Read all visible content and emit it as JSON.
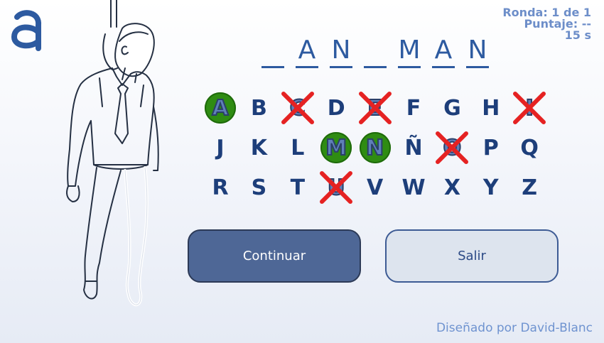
{
  "hud": {
    "round": "Ronda: 1 de 1",
    "score": "Puntaje: --",
    "timer": "15 s"
  },
  "word": {
    "slots": [
      "",
      "A",
      "N",
      "",
      "M",
      "A",
      "N"
    ]
  },
  "keyboard": {
    "rows": [
      [
        {
          "letter": "A",
          "state": "correct"
        },
        {
          "letter": "B",
          "state": "unused"
        },
        {
          "letter": "C",
          "state": "wrong"
        },
        {
          "letter": "D",
          "state": "unused"
        },
        {
          "letter": "E",
          "state": "wrong"
        },
        {
          "letter": "F",
          "state": "unused"
        },
        {
          "letter": "G",
          "state": "unused"
        },
        {
          "letter": "H",
          "state": "unused"
        },
        {
          "letter": "I",
          "state": "wrong"
        }
      ],
      [
        {
          "letter": "J",
          "state": "unused"
        },
        {
          "letter": "K",
          "state": "unused"
        },
        {
          "letter": "L",
          "state": "unused"
        },
        {
          "letter": "M",
          "state": "correct"
        },
        {
          "letter": "N",
          "state": "correct"
        },
        {
          "letter": "Ñ",
          "state": "unused"
        },
        {
          "letter": "O",
          "state": "wrong"
        },
        {
          "letter": "P",
          "state": "unused"
        },
        {
          "letter": "Q",
          "state": "unused"
        }
      ],
      [
        {
          "letter": "R",
          "state": "unused"
        },
        {
          "letter": "S",
          "state": "unused"
        },
        {
          "letter": "T",
          "state": "unused"
        },
        {
          "letter": "U",
          "state": "wrong"
        },
        {
          "letter": "V",
          "state": "unused"
        },
        {
          "letter": "W",
          "state": "unused"
        },
        {
          "letter": "X",
          "state": "unused"
        },
        {
          "letter": "Y",
          "state": "unused"
        },
        {
          "letter": "Z",
          "state": "unused"
        }
      ]
    ]
  },
  "buttons": {
    "continue_label": "Continuar",
    "exit_label": "Salir"
  },
  "credit": "Diseñado por David-Blanc",
  "colors": {
    "accent": "#2d5aa0",
    "correct": "#2f8c12",
    "wrong": "#e52222",
    "hud": "#6d8ec9"
  },
  "icons": {
    "logo": "a-logo-icon",
    "figure": "hanged-man-icon"
  }
}
